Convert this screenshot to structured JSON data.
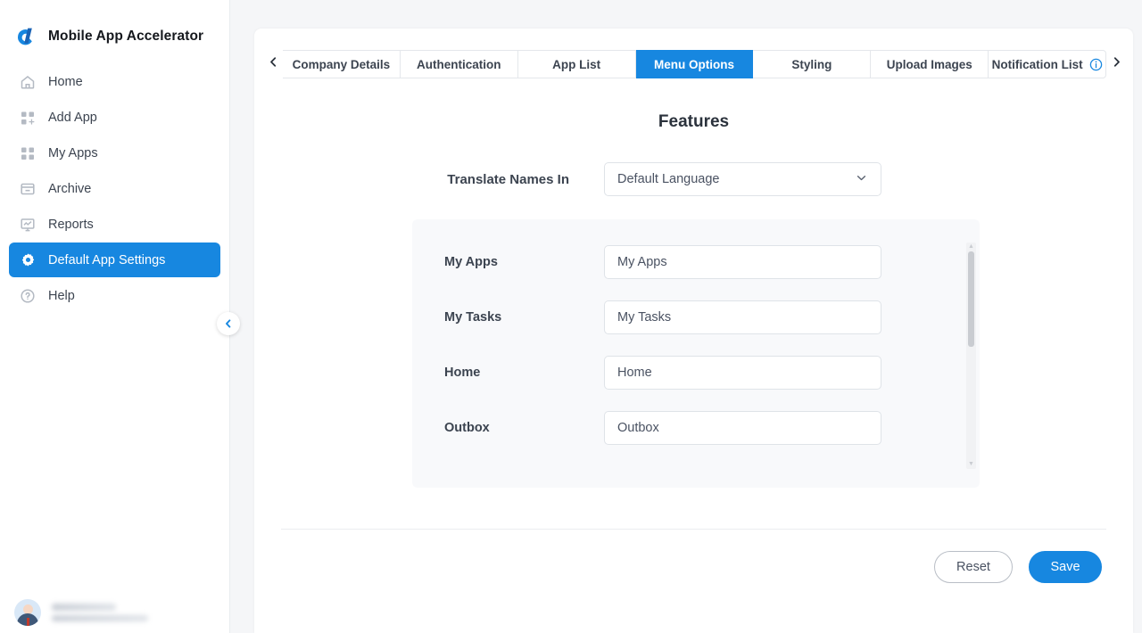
{
  "brand": {
    "title": "Mobile App Accelerator",
    "logo_icon": "app-accelerator-logo"
  },
  "sidebar": {
    "items": [
      {
        "label": "Home",
        "icon": "home-icon",
        "active": false
      },
      {
        "label": "Add App",
        "icon": "add-app-grid-icon",
        "active": false
      },
      {
        "label": "My Apps",
        "icon": "grid-icon",
        "active": false
      },
      {
        "label": "Archive",
        "icon": "archive-box-icon",
        "active": false
      },
      {
        "label": "Reports",
        "icon": "reports-chart-icon",
        "active": false
      },
      {
        "label": "Default App Settings",
        "icon": "gear-icon",
        "active": true
      },
      {
        "label": "Help",
        "icon": "question-circle-icon",
        "active": false
      }
    ],
    "collapse_icon": "chevron-left-icon",
    "user": {
      "avatar_icon": "user-avatar",
      "name_redacted": true
    }
  },
  "tabs": {
    "prev_icon": "chevron-left-icon",
    "next_icon": "chevron-right-icon",
    "info_icon": "info-circle-icon",
    "items": [
      {
        "label": "Company Details",
        "active": false
      },
      {
        "label": "Authentication",
        "active": false
      },
      {
        "label": "App List",
        "active": false
      },
      {
        "label": "Menu Options",
        "active": true
      },
      {
        "label": "Styling",
        "active": false
      },
      {
        "label": "Upload Images",
        "active": false
      },
      {
        "label": "Notification List",
        "active": false,
        "has_info": true
      }
    ]
  },
  "main": {
    "title": "Features",
    "translate": {
      "label": "Translate Names In",
      "value": "Default Language",
      "chevron_icon": "chevron-down-icon"
    },
    "feature_rows": [
      {
        "label": "My Apps",
        "value": "My Apps"
      },
      {
        "label": "My Tasks",
        "value": "My Tasks"
      },
      {
        "label": "Home",
        "value": "Home"
      },
      {
        "label": "Outbox",
        "value": "Outbox"
      }
    ],
    "scrollbar": {
      "up_icon": "caret-up-icon",
      "down_icon": "caret-down-icon"
    }
  },
  "actions": {
    "reset_label": "Reset",
    "save_label": "Save"
  },
  "colors": {
    "accent": "#1787e0",
    "page_bg": "#f5f6f8",
    "panel_bg": "#f8f9fb",
    "text": "#3c4450"
  }
}
